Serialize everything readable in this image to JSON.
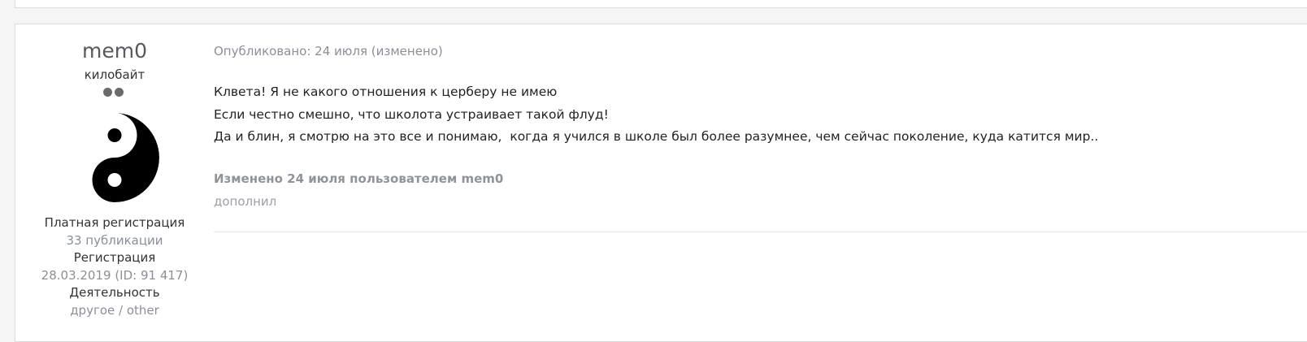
{
  "author": {
    "name": "mem0",
    "rank": "килобайт",
    "rank_pips": 2,
    "group": "Платная регистрация",
    "posts": "33 публикации",
    "joined_label": "Регистрация",
    "joined_value": "28.03.2019 (ID: 91 417)",
    "activity_label": "Деятельность",
    "activity_value": "другое / other",
    "avatar_icon": "yin-yang-avatar"
  },
  "post": {
    "date": "Опубликовано: 24 июля (изменено)",
    "lines": [
      "Клвета! Я не какого отношения к церберу не имею",
      "Если честно смешно, что школота устраивает такой флуд!",
      "Да и блин, я смотрю на это все и понимаю,  когда я учился в школе был более разумнее, чем сейчас поколение, куда катится мир.."
    ],
    "edited_note": "Изменено 24 июля пользователем mem0",
    "edit_reason": "дополнил"
  },
  "colors": {
    "muted_text": "#8a9099",
    "body_text": "#222222",
    "border": "#dcdcdc"
  }
}
